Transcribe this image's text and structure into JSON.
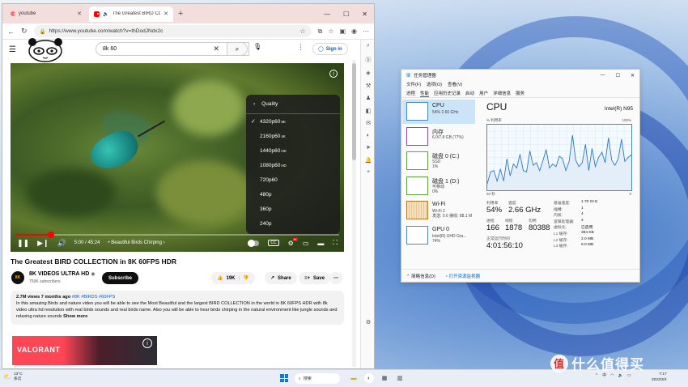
{
  "browser": {
    "tabs": [
      {
        "title": "youtube",
        "active": false
      },
      {
        "title": "The Greatest BIRD COLLECTI",
        "active": true
      }
    ],
    "url": "https://www.youtube.com/watch?v=thDodJNdx2c",
    "search_query": "8k 60",
    "signin_label": "Sign in"
  },
  "player": {
    "time": "5:00 / 45:24",
    "chapter": "• Beautiful Birds Chirping ›",
    "progress_fraction": 0.11,
    "quality_menu": {
      "title": "Quality",
      "options": [
        {
          "label": "4320p60",
          "badge": "8K",
          "selected": true
        },
        {
          "label": "2160p60",
          "badge": "4K",
          "selected": false
        },
        {
          "label": "1440p60",
          "badge": "HD",
          "selected": false
        },
        {
          "label": "1080p60",
          "badge": "HD",
          "selected": false
        },
        {
          "label": "720p60",
          "badge": "",
          "selected": false
        },
        {
          "label": "480p",
          "badge": "",
          "selected": false
        },
        {
          "label": "360p",
          "badge": "",
          "selected": false
        },
        {
          "label": "240p",
          "badge": "",
          "selected": false
        }
      ]
    }
  },
  "video": {
    "title": "The Greatest BIRD COLLECTION in 8K 60FPS HDR",
    "channel": "8K VIDEOS ULTRA HD",
    "channel_avatar_text": "8K",
    "subscribers": "759K subscribers",
    "subscribe_label": "Subscribe",
    "likes": "19K",
    "share_label": "Share",
    "save_label": "Save",
    "meta": "2.7M views  7 months ago",
    "tags": "#8K #BIRDS #60FPS",
    "description": "In this amazing Birds and nature video you will be able to see the Most Beautiful and the largest BIRD COLLECTION in the world in 8K 60FPS HDR with 8k video ultra hd resolution with real birds sounds and real birds name. Also you will be able to hear birds chirping in the natural environment like jungle sounds and relaxing nature sounds",
    "show_more": "Show more"
  },
  "ad": {
    "brand": "VALORANT"
  },
  "taskmgr": {
    "title": "任务管理器",
    "menu": [
      "文件(F)",
      "选项(O)",
      "查看(V)"
    ],
    "tabs": [
      "进程",
      "性能",
      "应用历史记录",
      "启动",
      "用户",
      "详细信息",
      "服务"
    ],
    "resources": [
      {
        "name": "CPU",
        "sub": "54%  2.66 GHz",
        "kind": "cpu",
        "active": true
      },
      {
        "name": "内存",
        "sub": "6.0/7.8 GB (77%)",
        "kind": "mem",
        "active": false
      },
      {
        "name": "磁盘 0 (C:)",
        "sub": "SSD\n1%",
        "kind": "disk",
        "active": false
      },
      {
        "name": "磁盘 1 (D:)",
        "sub": "可移动\n0%",
        "kind": "disk",
        "active": false
      },
      {
        "name": "Wi-Fi",
        "sub": "Wi-Fi 2\n发送: 0.6  接收: 88.1 M",
        "kind": "wifi",
        "active": false
      },
      {
        "name": "GPU 0",
        "sub": "Intel(R) UHD Gra...\n74%",
        "kind": "gpu",
        "active": false
      }
    ],
    "cpu": {
      "heading": "CPU",
      "model": "Intel(R) N95",
      "graph_label_top": "% 利用率",
      "graph_max": "100%",
      "graph_time": "60 秒",
      "graph_min": "0",
      "utilization_label": "利用率",
      "utilization": "54%",
      "speed_label": "速度",
      "speed": "2.66 GHz",
      "processes_label": "进程",
      "processes": "166",
      "threads_label": "线程",
      "threads": "1878",
      "handles_label": "句柄",
      "handles": "80388",
      "uptime_label": "正常运行时间",
      "uptime": "4:01:56:10",
      "details": [
        {
          "k": "基准速度:",
          "v": "1.70 GHz"
        },
        {
          "k": "插槽:",
          "v": "1"
        },
        {
          "k": "内核:",
          "v": "4"
        },
        {
          "k": "逻辑处理器:",
          "v": "4"
        },
        {
          "k": "虚拟化:",
          "v": "已启用"
        },
        {
          "k": "L1 缓存:",
          "v": "384 KB"
        },
        {
          "k": "L2 缓存:",
          "v": "2.0 MB"
        },
        {
          "k": "L3 缓存:",
          "v": "6.0 MB"
        }
      ],
      "history": [
        10,
        28,
        30,
        14,
        32,
        14,
        48,
        22,
        40,
        34,
        55,
        30,
        28,
        60,
        38,
        42,
        30,
        45,
        62,
        34,
        40,
        36,
        52,
        48,
        30,
        44,
        84,
        46,
        36,
        42,
        70,
        30,
        64,
        36,
        50,
        58,
        42,
        80,
        46,
        38,
        48,
        78,
        44,
        50,
        54
      ]
    },
    "footer": {
      "summary": "简略信息(D)",
      "open_monitor": "打开资源监视器"
    }
  },
  "taskbar": {
    "weather_temp": "13°C",
    "weather_desc": "多云",
    "search_label": "搜索",
    "time": "7:17",
    "date": "2023/3/4"
  },
  "watermark": {
    "badge": "值",
    "text": "什么值得买"
  }
}
